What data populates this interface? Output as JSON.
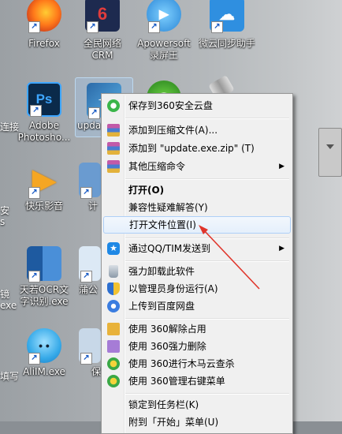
{
  "desktop": {
    "icons": [
      {
        "id": "firefox",
        "label1": "Firefox",
        "label2": "",
        "color": "#e66000"
      },
      {
        "id": "quanmin",
        "label1": "全民网络",
        "label2": "CRM",
        "color": "#1d2a4f"
      },
      {
        "id": "apowersoft",
        "label1": "Apowersoft",
        "label2": "录屏王",
        "color": "#3a9bdc"
      },
      {
        "id": "weiyun",
        "label1": "微云同步助手",
        "label2": "",
        "color": "#2f8fe0"
      },
      {
        "id": "photoshop",
        "label1": "Adobe",
        "label2": "Photosho...",
        "color": "#0b2a4a"
      },
      {
        "id": "update",
        "label1": "upda",
        "label2": "",
        "color": "#3a7fbf"
      },
      {
        "id": "kuaibo",
        "label1": "快乐影音",
        "label2": "",
        "color": "#f5a623"
      },
      {
        "id": "jisuan",
        "label1": "计",
        "label2": "",
        "color": "#6a9bd0"
      },
      {
        "id": "tianruo",
        "label1": "天若OCR文",
        "label2": "字识别.exe",
        "color": "#2b6cb0"
      },
      {
        "id": "pugong",
        "label1": "蒲公",
        "label2": "",
        "color": "#dce9f5"
      },
      {
        "id": "alitm",
        "label1": "AliIM.exe",
        "label2": "",
        "color": "#35a9e8"
      },
      {
        "id": "bao",
        "label1": "保",
        "label2": "",
        "color": "#c8d8e8"
      }
    ],
    "edge_labels": [
      "连接",
      "安",
      "s",
      "镜",
      "exe",
      "填写"
    ]
  },
  "context_menu": {
    "items": [
      {
        "label": "保存到360安全云盘",
        "icon": "cloud-360-icon",
        "color": "#3ab54a"
      },
      {
        "sep": true
      },
      {
        "label": "添加到压缩文件(A)...",
        "icon": "winrar-icon",
        "color": "#7b3f9e"
      },
      {
        "label": "添加到 \"update.exe.zip\" (T)",
        "icon": "winrar-icon",
        "color": "#7b3f9e"
      },
      {
        "label": "其他压缩命令",
        "icon": "winrar-icon",
        "color": "#7b3f9e",
        "submenu": "▶"
      },
      {
        "sep": true
      },
      {
        "label": "打开(O)",
        "bold": true
      },
      {
        "label": "兼容性疑难解答(Y)"
      },
      {
        "label": "打开文件位置(I)",
        "highlight": true
      },
      {
        "sep": true
      },
      {
        "label": "通过QQ/TIM发送到",
        "icon": "qq-icon",
        "color": "#1e88e5",
        "submenu": "▶"
      },
      {
        "sep": true
      },
      {
        "label": "强力卸载此软件",
        "icon": "trash-icon",
        "color": "#8c9aa8"
      },
      {
        "label": "以管理员身份运行(A)",
        "icon": "shield-icon",
        "color": "#2d6fd0"
      },
      {
        "label": "上传到百度网盘",
        "icon": "baidu-cloud-icon",
        "color": "#3b7de0"
      },
      {
        "sep": true
      },
      {
        "label": "使用 360解除占用",
        "icon": "unlock-360-icon",
        "color": "#e8b23a"
      },
      {
        "label": "使用 360强力删除",
        "icon": "delete-360-icon",
        "color": "#a67cd6"
      },
      {
        "label": "使用 360进行木马云查杀",
        "icon": "scan-360-icon",
        "color": "#3aa845"
      },
      {
        "label": "使用 360管理右键菜单",
        "icon": "manage-360-icon",
        "color": "#3aa845"
      },
      {
        "sep": true
      },
      {
        "label": "锁定到任务栏(K)"
      },
      {
        "label": "附到「开始」菜单(U)"
      }
    ]
  }
}
